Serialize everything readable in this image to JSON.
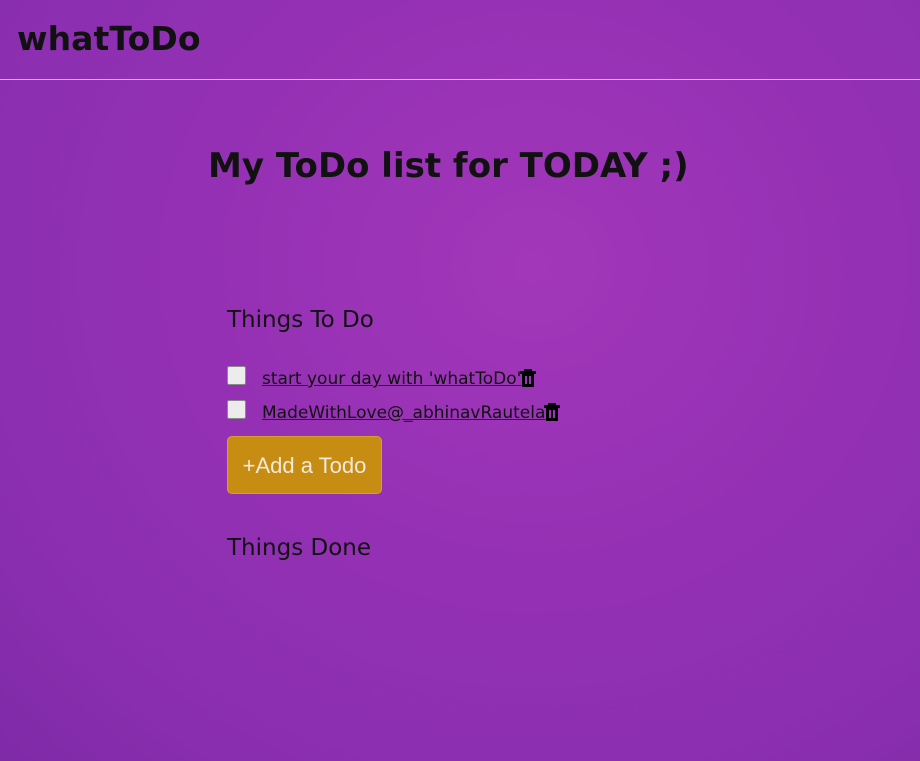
{
  "app": {
    "brand": "whatToDo"
  },
  "main": {
    "heading": "My ToDo list for TODAY ;)",
    "sections": {
      "todo_title": "Things To Do",
      "done_title": "Things Done"
    },
    "todos": [
      {
        "text": "start your day with 'whatToDo'",
        "checked": false,
        "delete_icon": "trash-icon"
      },
      {
        "text": "MadeWithLove@_abhinavRautela",
        "checked": false,
        "delete_icon": "trash-icon"
      }
    ],
    "add_button_label": "+Add a Todo"
  },
  "colors": {
    "background_gradient": [
      "#a237b9",
      "#7f2aa8"
    ],
    "accent_button": "#c68d12",
    "button_text": "#f1e9da",
    "text": "#111111"
  }
}
